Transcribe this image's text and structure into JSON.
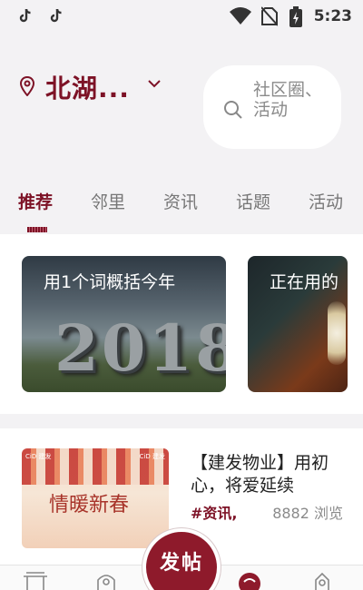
{
  "status_bar": {
    "time": "5:23",
    "left_icons": [
      "tiktok-icon",
      "tiktok-icon"
    ],
    "right_icons": [
      "wifi-icon",
      "no-sim-icon",
      "battery-charging-icon"
    ]
  },
  "header": {
    "location": "北湖...",
    "search_placeholder": "社区圈、活动"
  },
  "tabs": [
    {
      "label": "推荐",
      "active": true
    },
    {
      "label": "邻里",
      "active": false
    },
    {
      "label": "资讯",
      "active": false
    },
    {
      "label": "话题",
      "active": false
    },
    {
      "label": "活动",
      "active": false
    }
  ],
  "topic_cards": [
    {
      "caption": "用1个词概括今年",
      "image_text": "2018"
    },
    {
      "caption": "正在用的"
    }
  ],
  "article": {
    "thumb_title": "情暖新春",
    "title": "【建发物业】用初心，将爱延续",
    "tag": "#资讯,",
    "views": "8882 浏览"
  },
  "bottom_nav": {
    "post_button": "发帖",
    "icons": [
      "home-gate-icon",
      "neighborhood-icon",
      "post-icon",
      "service-icon",
      "profile-icon"
    ]
  },
  "colors": {
    "accent": "#7d1226",
    "background": "#f3f2f4",
    "fab": "#8e1a2b"
  }
}
